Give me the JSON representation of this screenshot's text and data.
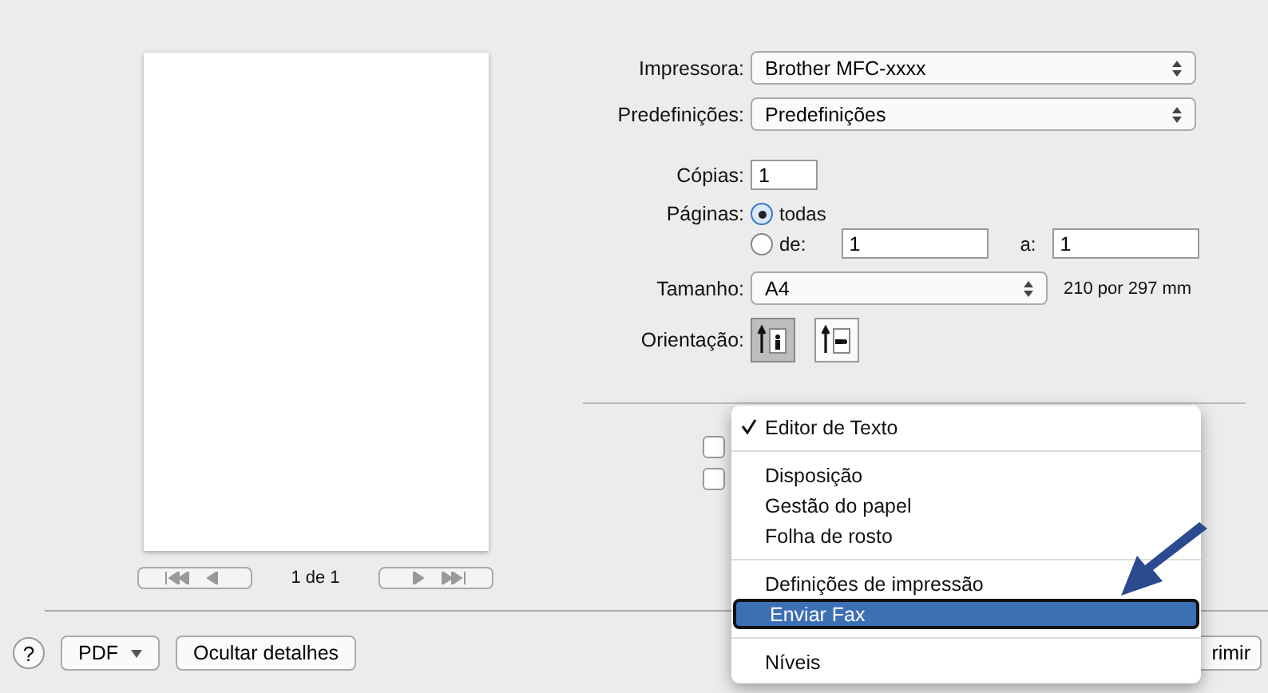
{
  "preview": {
    "page_indicator": "1 de 1"
  },
  "form": {
    "printer": {
      "label": "Impressora:",
      "value": "Brother MFC-xxxx"
    },
    "presets": {
      "label": "Predefinições:",
      "value": "Predefinições"
    },
    "copies": {
      "label": "Cópias:",
      "value": "1"
    },
    "pages": {
      "label": "Páginas:",
      "options": [
        {
          "label": "todas",
          "selected": true
        },
        {
          "label": "de:",
          "selected": false
        }
      ],
      "from": "1",
      "to_label": "a:",
      "to": "1"
    },
    "size": {
      "label": "Tamanho:",
      "value": "A4",
      "dimensions": "210 por 297 mm"
    },
    "orientation": {
      "label": "Orientação:",
      "options": [
        {
          "kind": "portrait",
          "selected": true
        },
        {
          "kind": "landscape",
          "selected": false
        }
      ]
    }
  },
  "checkboxes": [
    {
      "checked": false
    },
    {
      "checked": false
    }
  ],
  "menu": {
    "groups": [
      [
        {
          "label": "Editor de Texto",
          "checked": true,
          "selected": false
        }
      ],
      [
        {
          "label": "Disposição",
          "checked": false,
          "selected": false
        },
        {
          "label": "Gestão do papel",
          "checked": false,
          "selected": false
        },
        {
          "label": "Folha de rosto",
          "checked": false,
          "selected": false
        }
      ],
      [
        {
          "label": "Definições de impressão",
          "checked": false,
          "selected": false
        },
        {
          "label": "Enviar Fax",
          "checked": false,
          "selected": true
        }
      ],
      [
        {
          "label": "Níveis",
          "checked": false,
          "selected": false
        }
      ]
    ]
  },
  "footer": {
    "help": "?",
    "pdf": "PDF",
    "hide_details": "Ocultar detalhes",
    "print_button": "rimir"
  }
}
